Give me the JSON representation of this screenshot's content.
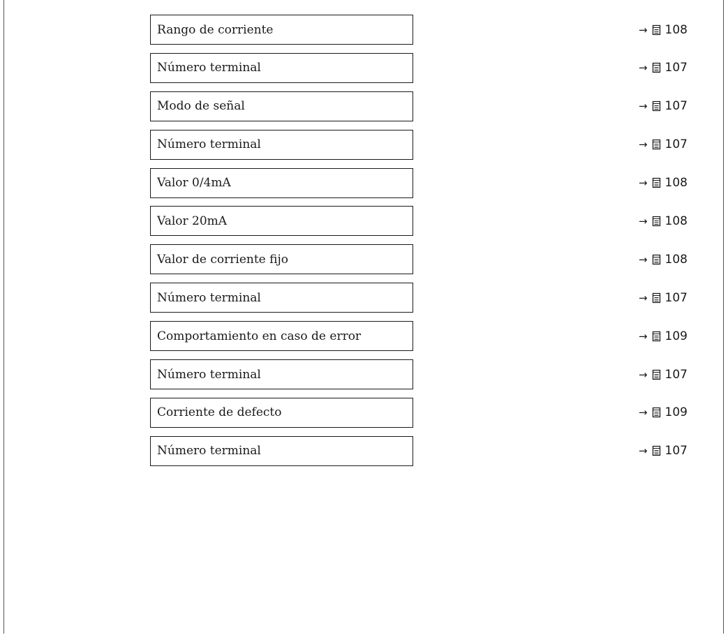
{
  "rows": [
    {
      "label": "Rango de corriente",
      "arrow": "→",
      "page": "108"
    },
    {
      "label": "Número terminal",
      "arrow": "→",
      "page": "107"
    },
    {
      "label": "Modo de señal",
      "arrow": "→",
      "page": "107"
    },
    {
      "label": "Número terminal",
      "arrow": "→",
      "page": "107"
    },
    {
      "label": "Valor 0/4mA",
      "arrow": "→",
      "page": "108"
    },
    {
      "label": "Valor 20mA",
      "arrow": "→",
      "page": "108"
    },
    {
      "label": "Valor de corriente fijo",
      "arrow": "→",
      "page": "108"
    },
    {
      "label": "Número terminal",
      "arrow": "→",
      "page": "107"
    },
    {
      "label": "Comportamiento en caso de error",
      "arrow": "→",
      "page": "109"
    },
    {
      "label": "Número terminal",
      "arrow": "→",
      "page": "107"
    },
    {
      "label": "Corriente de defecto",
      "arrow": "→",
      "page": "109"
    },
    {
      "label": "Número terminal",
      "arrow": "→",
      "page": "107"
    }
  ],
  "icons": {
    "reference": "book-page-icon"
  }
}
